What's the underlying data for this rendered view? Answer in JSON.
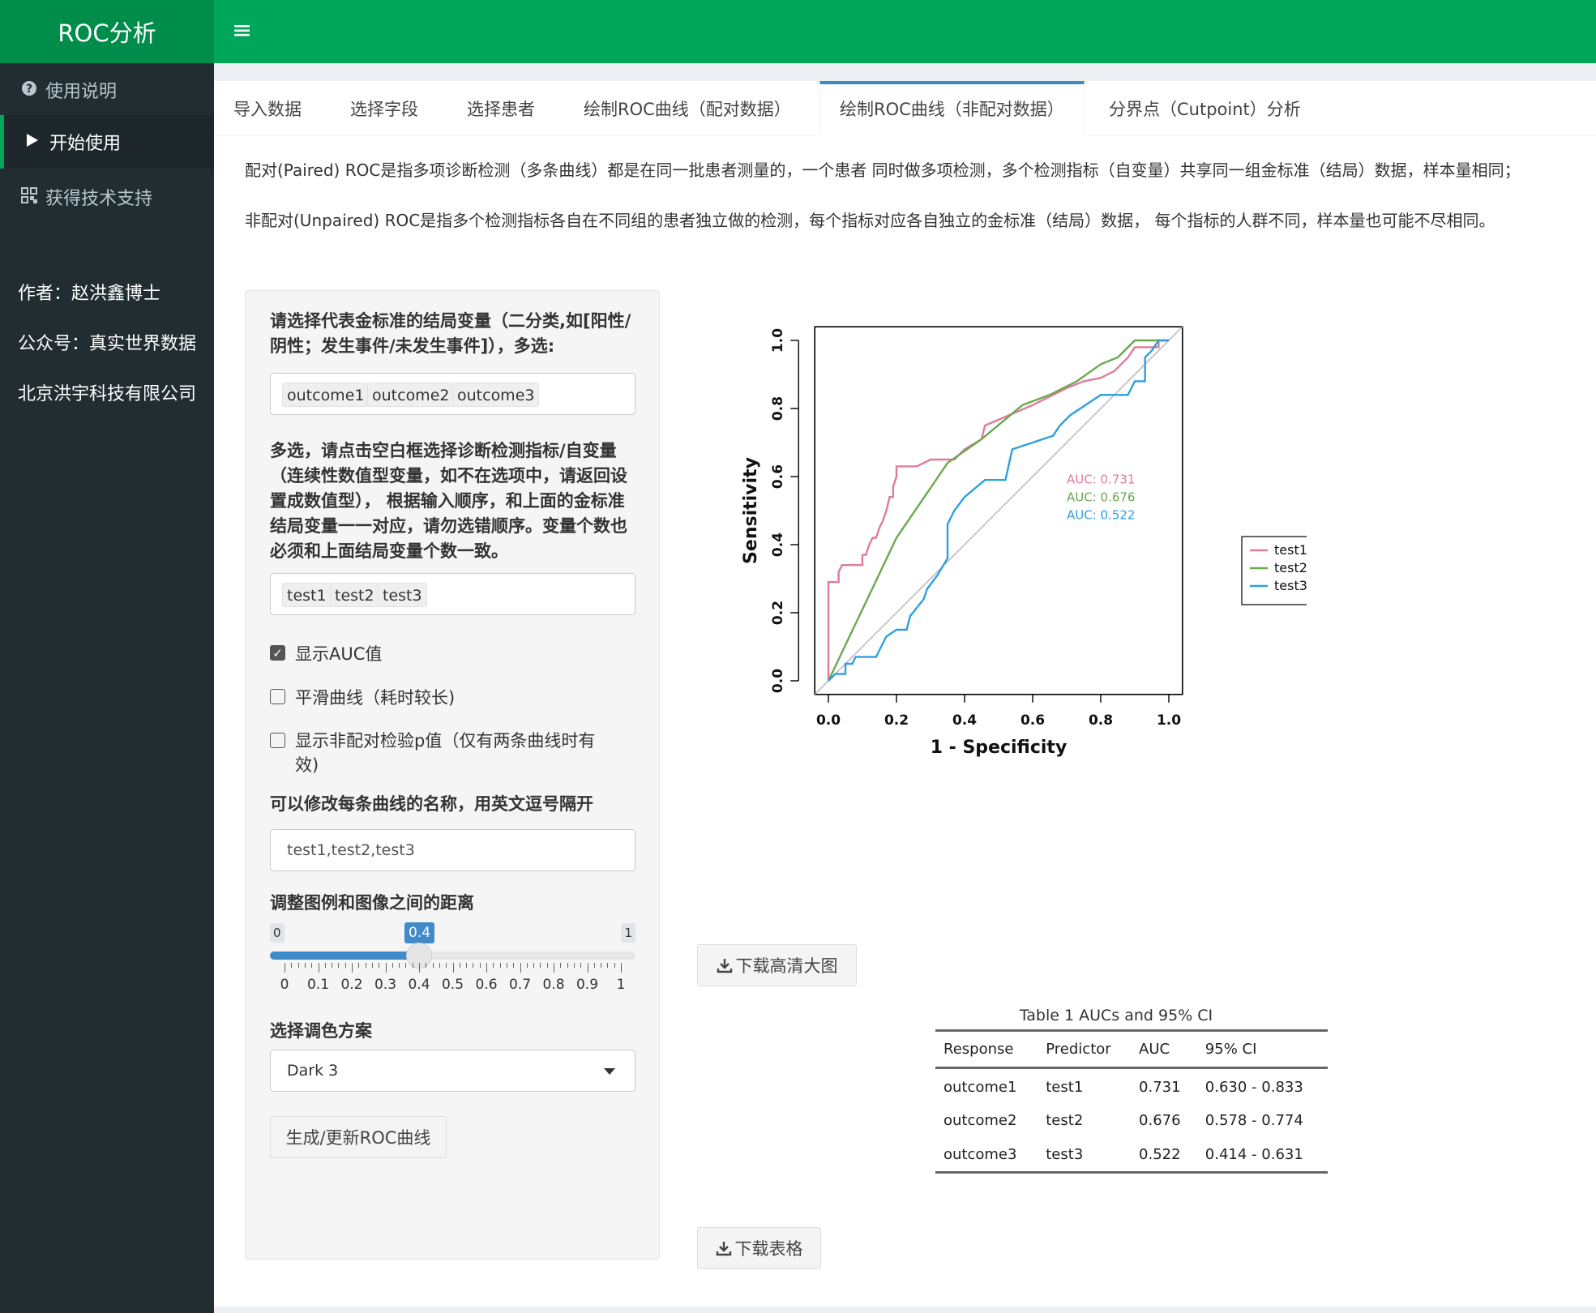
{
  "app": {
    "title": "ROC分析",
    "menu_icon": "bars-icon"
  },
  "sidebar": {
    "items": [
      {
        "label": "使用说明",
        "icon": "question-circle-icon"
      },
      {
        "label": "开始使用",
        "icon": "play-icon"
      },
      {
        "label": "获得技术支持",
        "icon": "qrcode-icon"
      }
    ],
    "texts": [
      "作者：赵洪鑫博士",
      "公众号：真实世界数据",
      "北京洪宇科技有限公司"
    ]
  },
  "tabs": [
    "导入数据",
    "选择字段",
    "选择患者",
    "绘制ROC曲线（配对数据）",
    "绘制ROC曲线（非配对数据）",
    "分界点（Cutpoint）分析"
  ],
  "active_tab": "绘制ROC曲线（非配对数据）",
  "intro": {
    "p1": "配对(Paired) ROC是指多项诊断检测（多条曲线）都是在同一批患者测量的，一个患者 同时做多项检测，多个检测指标（自变量）共享同一组金标准（结局）数据，样本量相同；",
    "p2": "非配对(Unpaired) ROC是指多个检测指标各自在不同组的患者独立做的检测，每个指标对应各自独立的金标准（结局）数据， 每个指标的人群不同，样本量也可能不尽相同。"
  },
  "form": {
    "outcome_label": "请选择代表金标准的结局变量（二分类,如[阳性/阴性；发生事件/未发生事件]），多选:",
    "outcome_chips": [
      "outcome1",
      "outcome2",
      "outcome3"
    ],
    "predictor_label": "多选，请点击空白框选择诊断检测指标/自变量（连续性数值型变量，如不在选项中，请返回设置成数值型）， 根据输入顺序，和上面的金标准结局变量一一对应，请勿选错顺序。变量个数也必须和上面结局变量个数一致。",
    "predictor_chips": [
      "test1",
      "test2",
      "test3"
    ],
    "check_auc": {
      "label": "显示AUC值",
      "checked": true
    },
    "check_smooth": {
      "label": "平滑曲线（耗时较长)",
      "checked": false
    },
    "check_p": {
      "label": "显示非配对检验p值（仅有两条曲线时有效)",
      "checked": false
    },
    "names_label": "可以修改每条曲线的名称，用英文逗号隔开",
    "names_value": "test1,test2,test3",
    "slider_label": "调整图例和图像之间的距离",
    "slider": {
      "min": "0",
      "max": "1",
      "value": 0.4,
      "value_text": "0.4",
      "ticks": [
        "0",
        "0.1",
        "0.2",
        "0.3",
        "0.4",
        "0.5",
        "0.6",
        "0.7",
        "0.8",
        "0.9",
        "1"
      ]
    },
    "palette_label": "选择调色方案",
    "palette_value": "Dark 3",
    "submit_label": "生成/更新ROC曲线"
  },
  "buttons": {
    "download_plot": "下载高清大图",
    "download_table": "下载表格",
    "download_icon": "download-icon"
  },
  "chart_data": {
    "type": "line",
    "xlabel": "1 - Specificity",
    "ylabel": "Sensitivity",
    "xlim": [
      0,
      1
    ],
    "ylim": [
      0,
      1
    ],
    "x_ticks": [
      "0.0",
      "0.2",
      "0.4",
      "0.6",
      "0.8",
      "1.0"
    ],
    "y_ticks": [
      "0.0",
      "0.2",
      "0.4",
      "0.6",
      "0.8",
      "1.0"
    ],
    "legend_position": "right",
    "series": [
      {
        "name": "test1",
        "color": "#e07b9b",
        "auc_label": "AUC: 0.731",
        "points": [
          [
            0,
            0
          ],
          [
            0,
            0.29
          ],
          [
            0.03,
            0.29
          ],
          [
            0.03,
            0.32
          ],
          [
            0.04,
            0.34
          ],
          [
            0.1,
            0.34
          ],
          [
            0.1,
            0.37
          ],
          [
            0.11,
            0.37
          ],
          [
            0.12,
            0.4
          ],
          [
            0.13,
            0.42
          ],
          [
            0.14,
            0.42
          ],
          [
            0.15,
            0.45
          ],
          [
            0.16,
            0.47
          ],
          [
            0.17,
            0.5
          ],
          [
            0.18,
            0.54
          ],
          [
            0.19,
            0.54
          ],
          [
            0.19,
            0.57
          ],
          [
            0.2,
            0.6
          ],
          [
            0.2,
            0.63
          ],
          [
            0.26,
            0.63
          ],
          [
            0.3,
            0.65
          ],
          [
            0.37,
            0.65
          ],
          [
            0.4,
            0.68
          ],
          [
            0.45,
            0.71
          ],
          [
            0.46,
            0.75
          ],
          [
            0.53,
            0.78
          ],
          [
            0.6,
            0.81
          ],
          [
            0.7,
            0.86
          ],
          [
            0.75,
            0.88
          ],
          [
            0.8,
            0.89
          ],
          [
            0.84,
            0.91
          ],
          [
            0.88,
            0.95
          ],
          [
            0.9,
            0.98
          ],
          [
            0.97,
            0.98
          ],
          [
            0.97,
            1.0
          ],
          [
            1.0,
            1.0
          ]
        ]
      },
      {
        "name": "test2",
        "color": "#6aa84f",
        "auc_label": "AUC: 0.676",
        "points": [
          [
            0,
            0
          ],
          [
            0.2,
            0.42
          ],
          [
            0.35,
            0.64
          ],
          [
            0.45,
            0.71
          ],
          [
            0.57,
            0.81
          ],
          [
            0.65,
            0.84
          ],
          [
            0.73,
            0.88
          ],
          [
            0.8,
            0.93
          ],
          [
            0.85,
            0.95
          ],
          [
            0.9,
            1.0
          ],
          [
            1.0,
            1.0
          ]
        ]
      },
      {
        "name": "test3",
        "color": "#2e9fdf",
        "auc_label": "AUC: 0.522",
        "points": [
          [
            0,
            0
          ],
          [
            0.02,
            0.02
          ],
          [
            0.05,
            0.02
          ],
          [
            0.05,
            0.05
          ],
          [
            0.07,
            0.05
          ],
          [
            0.08,
            0.07
          ],
          [
            0.14,
            0.07
          ],
          [
            0.17,
            0.13
          ],
          [
            0.2,
            0.15
          ],
          [
            0.23,
            0.15
          ],
          [
            0.24,
            0.19
          ],
          [
            0.28,
            0.24
          ],
          [
            0.29,
            0.27
          ],
          [
            0.32,
            0.31
          ],
          [
            0.35,
            0.36
          ],
          [
            0.35,
            0.46
          ],
          [
            0.37,
            0.5
          ],
          [
            0.4,
            0.54
          ],
          [
            0.46,
            0.59
          ],
          [
            0.52,
            0.59
          ],
          [
            0.54,
            0.68
          ],
          [
            0.6,
            0.7
          ],
          [
            0.66,
            0.72
          ],
          [
            0.68,
            0.75
          ],
          [
            0.71,
            0.78
          ],
          [
            0.77,
            0.82
          ],
          [
            0.8,
            0.84
          ],
          [
            0.88,
            0.84
          ],
          [
            0.9,
            0.88
          ],
          [
            0.93,
            0.88
          ],
          [
            0.93,
            0.95
          ],
          [
            0.95,
            0.97
          ],
          [
            0.97,
            1.0
          ],
          [
            1.0,
            1.0
          ]
        ]
      }
    ]
  },
  "table": {
    "caption": "Table 1 AUCs and 95% CI",
    "headers": [
      "Response",
      "Predictor",
      "AUC",
      "95% CI"
    ],
    "rows": [
      [
        "outcome1",
        "test1",
        "0.731",
        "0.630 - 0.833"
      ],
      [
        "outcome2",
        "test2",
        "0.676",
        "0.578 - 0.774"
      ],
      [
        "outcome3",
        "test3",
        "0.522",
        "0.414 - 0.631"
      ]
    ]
  }
}
